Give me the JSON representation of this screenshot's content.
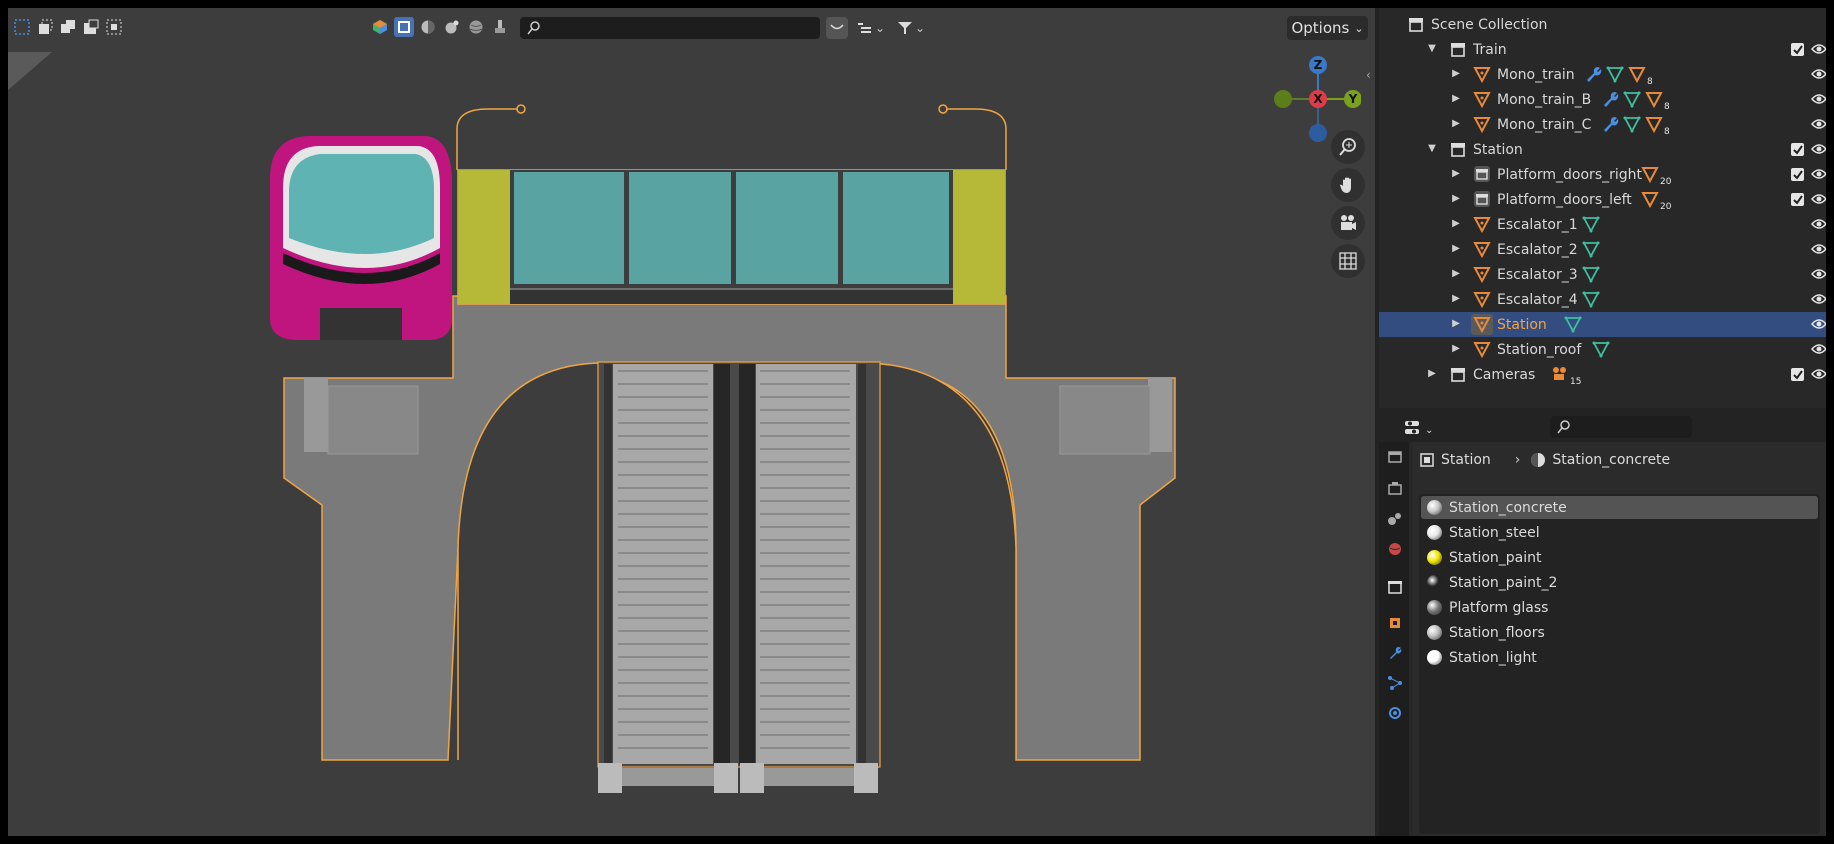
{
  "viewport": {
    "options_label": "Options",
    "search_placeholder": ""
  },
  "gizmo": {
    "z": "Z",
    "x": "X",
    "y": "Y"
  },
  "outliner": {
    "rows": [
      {
        "label": "Scene Collection",
        "type": "scene"
      },
      {
        "label": "Train",
        "type": "collection"
      },
      {
        "label": "Mono_train",
        "type": "object",
        "count": "8"
      },
      {
        "label": "Mono_train_B",
        "type": "object",
        "count": "8"
      },
      {
        "label": "Mono_train_C",
        "type": "object",
        "count": "8"
      },
      {
        "label": "Station",
        "type": "collection"
      },
      {
        "label": "Platform_doors_right",
        "type": "collection-object",
        "count": "20"
      },
      {
        "label": "Platform_doors_left",
        "type": "collection-object",
        "count": "20"
      },
      {
        "label": "Escalator_1",
        "type": "object"
      },
      {
        "label": "Escalator_2",
        "type": "object"
      },
      {
        "label": "Escalator_3",
        "type": "object"
      },
      {
        "label": "Escalator_4",
        "type": "object"
      },
      {
        "label": "Station",
        "type": "object",
        "selected": true
      },
      {
        "label": "Station_roof",
        "type": "object"
      },
      {
        "label": "Cameras",
        "type": "collection",
        "count": "15"
      }
    ]
  },
  "properties": {
    "breadcrumb_object": "Station",
    "breadcrumb_material": "Station_concrete",
    "materials": [
      {
        "name": "Station_concrete",
        "color": "#c8c8c8",
        "selected": true
      },
      {
        "name": "Station_steel",
        "color": "#e8e8e8"
      },
      {
        "name": "Station_paint",
        "color": "#f2e500"
      },
      {
        "name": "Station_paint_2",
        "color": "#222222"
      },
      {
        "name": "Platform glass",
        "color": "#777777"
      },
      {
        "name": "Station_floors",
        "color": "#bdbdbd"
      },
      {
        "name": "Station_light",
        "color": "#ffffff"
      }
    ]
  },
  "colors": {
    "accent": "#4772b3",
    "selection_outline": "#f0a544",
    "selected_row": "#334d80"
  }
}
